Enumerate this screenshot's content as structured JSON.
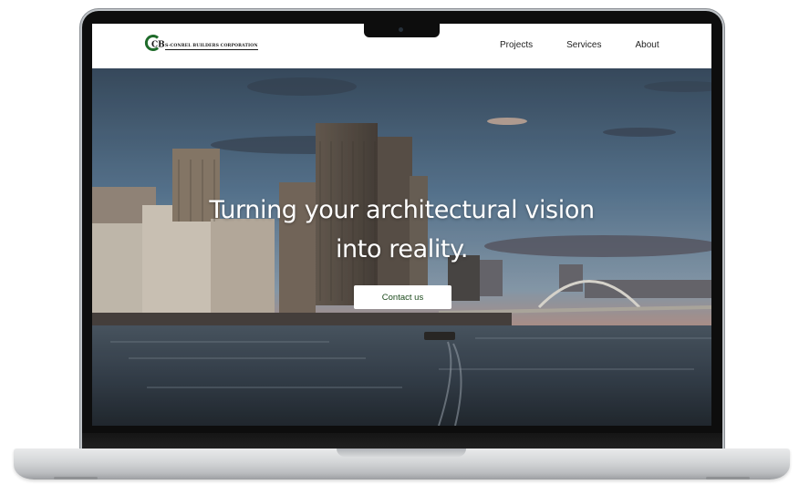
{
  "brand": {
    "logo_text": "S-CONREL BUILDERS CORPORATION",
    "logo_mark_letters": "CB",
    "accent_green": "#1f6b2a"
  },
  "nav": {
    "items": [
      {
        "label": "Projects"
      },
      {
        "label": "Services"
      },
      {
        "label": "About"
      }
    ]
  },
  "hero": {
    "headline_line1": "Turning your architectural vision",
    "headline_line2": "into reality.",
    "cta_label": "Contact us",
    "cta_text_color": "#1c4a1c"
  },
  "device": {
    "frame": "laptop",
    "color": "silver"
  }
}
